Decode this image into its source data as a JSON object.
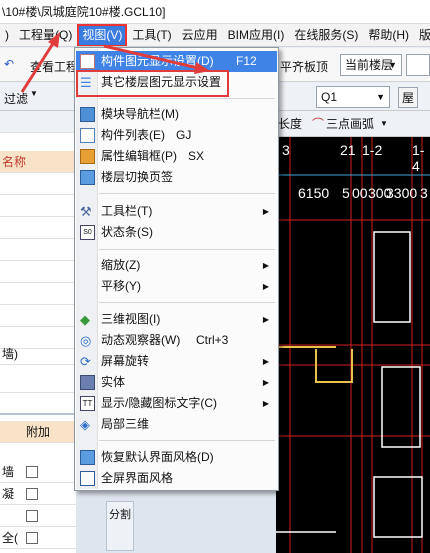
{
  "window": {
    "title": "\\10#楼\\凤城庭院10#楼.GCL10]"
  },
  "menubar": {
    "items": [
      ")",
      "工程量(Q)",
      "视图(V)",
      "工具(T)",
      "云应用",
      "BIM应用(I)",
      "在线服务(S)",
      "帮助(H)",
      "版"
    ]
  },
  "toolbar1": {
    "left_text": "查看工程",
    "right_text": "平齐板顶",
    "floor_combo": "当前楼层"
  },
  "toolbar2": {
    "filter": "过滤",
    "layer_combo": "Q1",
    "right_btn": "屋"
  },
  "subtoolbar": {
    "length_label": "长度",
    "arc_label": "三点画弧"
  },
  "left_panel": {
    "name_header": "名称",
    "row_item": "墙)",
    "col_header": "附加",
    "rows": [
      "墙",
      "凝",
      "",
      "全("
    ],
    "split_btn": "分割"
  },
  "canvas": {
    "axis_labels": [
      "3",
      "21",
      "1-2",
      "1-4"
    ],
    "dims": [
      "6150",
      "5",
      "00",
      "300",
      "3300",
      "3"
    ]
  },
  "view_menu": {
    "items": [
      {
        "label": "构件图元显示设置(D)",
        "shortcut": "F12",
        "icon": "component-display-icon",
        "highlight": true
      },
      {
        "label": "其它楼层图元显示设置",
        "shortcut": "",
        "icon": "other-floor-display-icon"
      },
      {
        "label": "模块导航栏(M)",
        "shortcut": "",
        "icon": "module-nav-icon"
      },
      {
        "label": "构件列表(E)",
        "shortcut": "GJ",
        "icon": "component-list-icon"
      },
      {
        "label": "属性编辑框(P)",
        "shortcut": "SX",
        "icon": "property-editor-icon"
      },
      {
        "label": "楼层切换页签",
        "shortcut": "",
        "icon": "floor-tab-icon"
      },
      {
        "label": "工具栏(T)",
        "shortcut": "",
        "icon": "toolbar-icon",
        "submenu": true
      },
      {
        "label": "状态条(S)",
        "shortcut": "",
        "icon": "statusbar-icon"
      },
      {
        "label": "缩放(Z)",
        "shortcut": "",
        "icon": "",
        "submenu": true
      },
      {
        "label": "平移(Y)",
        "shortcut": "",
        "icon": "",
        "submenu": true
      },
      {
        "label": "三维视图(I)",
        "shortcut": "",
        "icon": "3d-view-icon",
        "submenu": true
      },
      {
        "label": "动态观察器(W)",
        "shortcut": "Ctrl+3",
        "icon": "dynamic-observer-icon"
      },
      {
        "label": "屏幕旋转",
        "shortcut": "",
        "icon": "screen-rotate-icon",
        "submenu": true
      },
      {
        "label": "实体",
        "shortcut": "",
        "icon": "solid-icon",
        "submenu": true
      },
      {
        "label": "显示/隐藏图标文字(C)",
        "shortcut": "",
        "icon": "icon-text-toggle-icon",
        "submenu": true
      },
      {
        "label": "局部三维",
        "shortcut": "",
        "icon": "local-3d-icon"
      },
      {
        "label": "恢复默认界面风格(D)",
        "shortcut": "",
        "icon": "restore-style-icon"
      },
      {
        "label": "全屏界面风格",
        "shortcut": "",
        "icon": "fullscreen-icon"
      }
    ]
  },
  "colors": {
    "accent": "#3f83e6",
    "annotation_red": "#e13c3c",
    "canvas_bg": "#000000",
    "grid_red": "#d02020",
    "grid_yellow": "#e8c24a"
  }
}
